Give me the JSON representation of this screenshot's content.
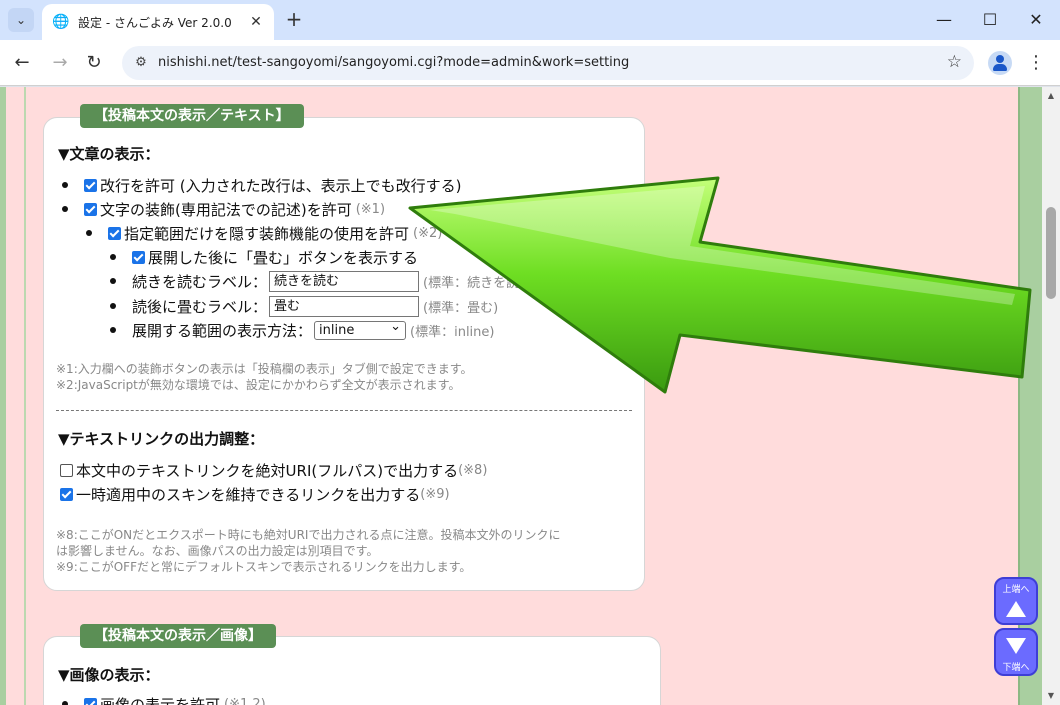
{
  "browser": {
    "tab_title": "設定 - さんごよみ Ver 2.0.0",
    "url": "nishishi.net/test-sangoyomi/sangoyomi.cgi?mode=admin&work=setting"
  },
  "panel1": {
    "tag": "【投稿本文の表示／テキスト】",
    "section1": {
      "heading": "▼文章の表示：",
      "allow_linebreak": "改行を許可 (入力された改行は、表示上でも改行する)",
      "allow_decoration": "文字の装飾(専用記法での記述)を許可",
      "allow_decoration_hint": "(※1)",
      "hide_range": "指定範囲だけを隠す装飾機能の使用を許可",
      "hide_range_hint": "(※2)",
      "fold_button": "展開した後に「畳む」ボタンを表示する",
      "continue_label": "続きを読むラベル：",
      "continue_value": "続きを読む",
      "continue_hint": "(標準：続きを読む)",
      "fold_label": "読後に畳むラベル：",
      "fold_value": "畳む",
      "fold_hint": "(標準：畳む)",
      "display_method_label": "展開する範囲の表示方法：",
      "display_method_value": "inline",
      "display_method_hint": "(標準：inline)",
      "note1": "※1:入力欄への装飾ボタンの表示は「投稿欄の表示」タブ側で設定できます。",
      "note2": "※2:JavaScriptが無効な環境では、設定にかかわらず全文が表示されます。"
    },
    "section2": {
      "heading": "▼テキストリンクの出力調整：",
      "absolute_uri": "本文中のテキストリンクを絶対URI(フルパス)で出力する",
      "absolute_uri_hint": "(※8)",
      "keep_skin": "一時適用中のスキンを維持できるリンクを出力する",
      "keep_skin_hint": "(※9)",
      "note8a": "※8:ここがONだとエクスポート時にも絶対URIで出力される点に注意。投稿本文外のリンクに",
      "note8b": "は影響しません。なお、画像パスの出力設定は別項目です。",
      "note9": "※9:ここがOFFだと常にデフォルトスキンで表示されるリンクを出力します。"
    }
  },
  "panel2": {
    "tag": "【投稿本文の表示／画像】",
    "heading": "▼画像の表示：",
    "allow_image": "画像の表示を許可",
    "allow_image_hint": "(※1,2)"
  },
  "jump": {
    "top_label": "上端へ",
    "bottom_label": "下端へ"
  },
  "colors": {
    "page_bg": "#ffdcdc",
    "panel_tag": "#5b8f55",
    "checkbox_on": "#1a73e8",
    "arrow_green": "#5fd11c",
    "jump_button": "#6b6bff"
  }
}
